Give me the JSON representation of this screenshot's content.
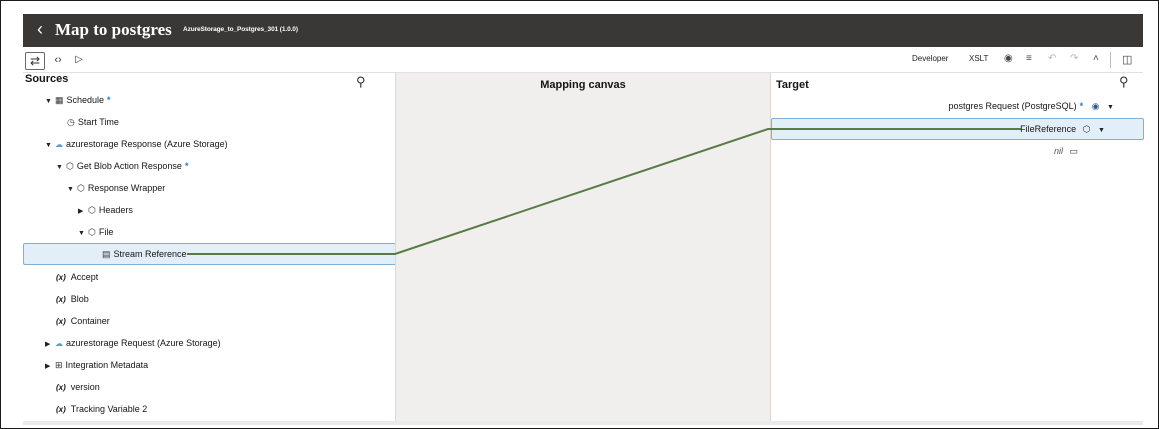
{
  "header": {
    "title": "Map to postgres",
    "subtitle": "AzureStorage_to_Postgres_301 (1.0.0)"
  },
  "toolbar": {
    "developer_label": "Developer",
    "xslt_label": "XSLT"
  },
  "sources": {
    "title": "Sources",
    "items": [
      {
        "label": "Schedule",
        "required": "*"
      },
      {
        "label": "Start Time"
      },
      {
        "label": "azurestorage Response (Azure Storage)"
      },
      {
        "label": "Get Blob Action Response",
        "required": "*"
      },
      {
        "label": "Response Wrapper"
      },
      {
        "label": "Headers"
      },
      {
        "label": "File"
      },
      {
        "label": "Stream Reference"
      },
      {
        "label": "Accept",
        "var": "(x)"
      },
      {
        "label": "Blob",
        "var": "(x)"
      },
      {
        "label": "Container",
        "var": "(x)"
      },
      {
        "label": "azurestorage Request (Azure Storage)"
      },
      {
        "label": "Integration Metadata"
      },
      {
        "label": "version",
        "var": "(x)"
      },
      {
        "label": "Tracking Variable 2",
        "var": "(x)"
      }
    ]
  },
  "canvas": {
    "title": "Mapping canvas"
  },
  "target": {
    "title": "Target",
    "root": {
      "label": "postgres Request (PostgreSQL)",
      "required": "*"
    },
    "file_reference": "FileReference",
    "nil_label": "nil"
  },
  "colors": {
    "header_bg": "#3a3836",
    "wire": "#5a7a44",
    "selected_bg": "#e3eff8",
    "required": "#227fc1"
  }
}
